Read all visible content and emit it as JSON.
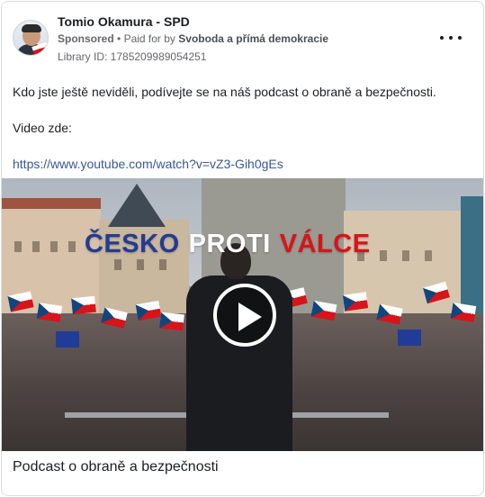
{
  "ad": {
    "page_name": "Tomio Okamura - SPD",
    "sponsored_label": "Sponsored",
    "separator": "•",
    "paid_for_by_label": "Paid for by",
    "payer": "Svoboda a přímá demokracie",
    "library_id": "Library ID: 1785209989054251"
  },
  "post": {
    "line1": "Kdo jste ještě neviděli, podívejte se na náš podcast o obraně a bezpečnosti.",
    "line2": "Video zde:",
    "link": "https://www.youtube.com/watch?v=vZ3-Gih0gEs"
  },
  "video": {
    "title_word1": "ČESKO",
    "title_word2": "PROTI",
    "title_word3": "VÁLCE",
    "colors": {
      "word1": "#233b93",
      "word2": "#ffffff",
      "word3": "#d7141a"
    },
    "play_icon": "play-icon"
  },
  "caption": "Podcast o obraně a bezpečnosti",
  "icons": {
    "more": "more-options-icon",
    "avatar": "page-avatar"
  }
}
